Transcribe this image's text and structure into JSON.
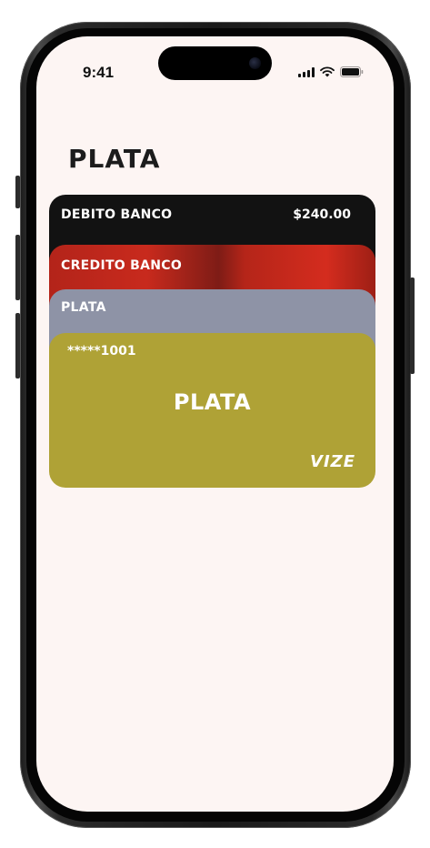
{
  "status_bar": {
    "time": "9:41"
  },
  "page": {
    "title": "PLATA"
  },
  "cards": [
    {
      "label": "DEBITO BANCO",
      "amount": "$240.00",
      "color": "#121212"
    },
    {
      "label": "CREDITO BANCO",
      "color": "#c82a1d"
    },
    {
      "label": "PLATA",
      "color": "#8e93a6"
    }
  ],
  "selected_card": {
    "number": "*****1001",
    "name": "PLATA",
    "brand": "VIZE",
    "color": "#afa236"
  },
  "icons": [
    "signal-icon",
    "wifi-icon",
    "battery-icon"
  ]
}
